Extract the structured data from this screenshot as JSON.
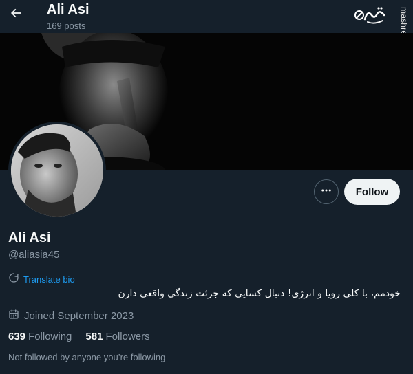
{
  "header": {
    "name": "Ali Asi",
    "posts_count": "169 posts"
  },
  "watermark": {
    "logo_text": "مشرق",
    "site": "mashreghnews.ir"
  },
  "profile": {
    "display_name": "Ali Asi",
    "handle": "@aliasia45",
    "translate_label": "Translate bio",
    "bio": "خودمم، با کلی رویا و انرژی! دنبال کسایی که جرئت زندگی واقعی دارن",
    "joined": "Joined September 2023",
    "following_count": "639",
    "following_label": "Following",
    "followers_count": "581",
    "followers_label": "Followers",
    "not_followed": "Not followed by anyone you’re following"
  },
  "actions": {
    "follow_label": "Follow"
  },
  "icons": {
    "back": "arrow-left-icon",
    "more": "more-dots-icon",
    "translate": "translate-icon",
    "calendar": "calendar-icon"
  },
  "colors": {
    "background": "#15202b",
    "accent": "#1d9bf0",
    "secondary_text": "#8b98a5"
  }
}
